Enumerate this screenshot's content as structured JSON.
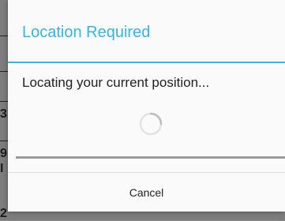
{
  "dialog": {
    "title": "Location Required",
    "message": "Locating your current position...",
    "cancel_label": "Cancel",
    "accent_color": "#33b5e5"
  },
  "background": {
    "fragments": [
      "3",
      "9",
      "I",
      "2"
    ],
    "bottom_text": "2"
  }
}
